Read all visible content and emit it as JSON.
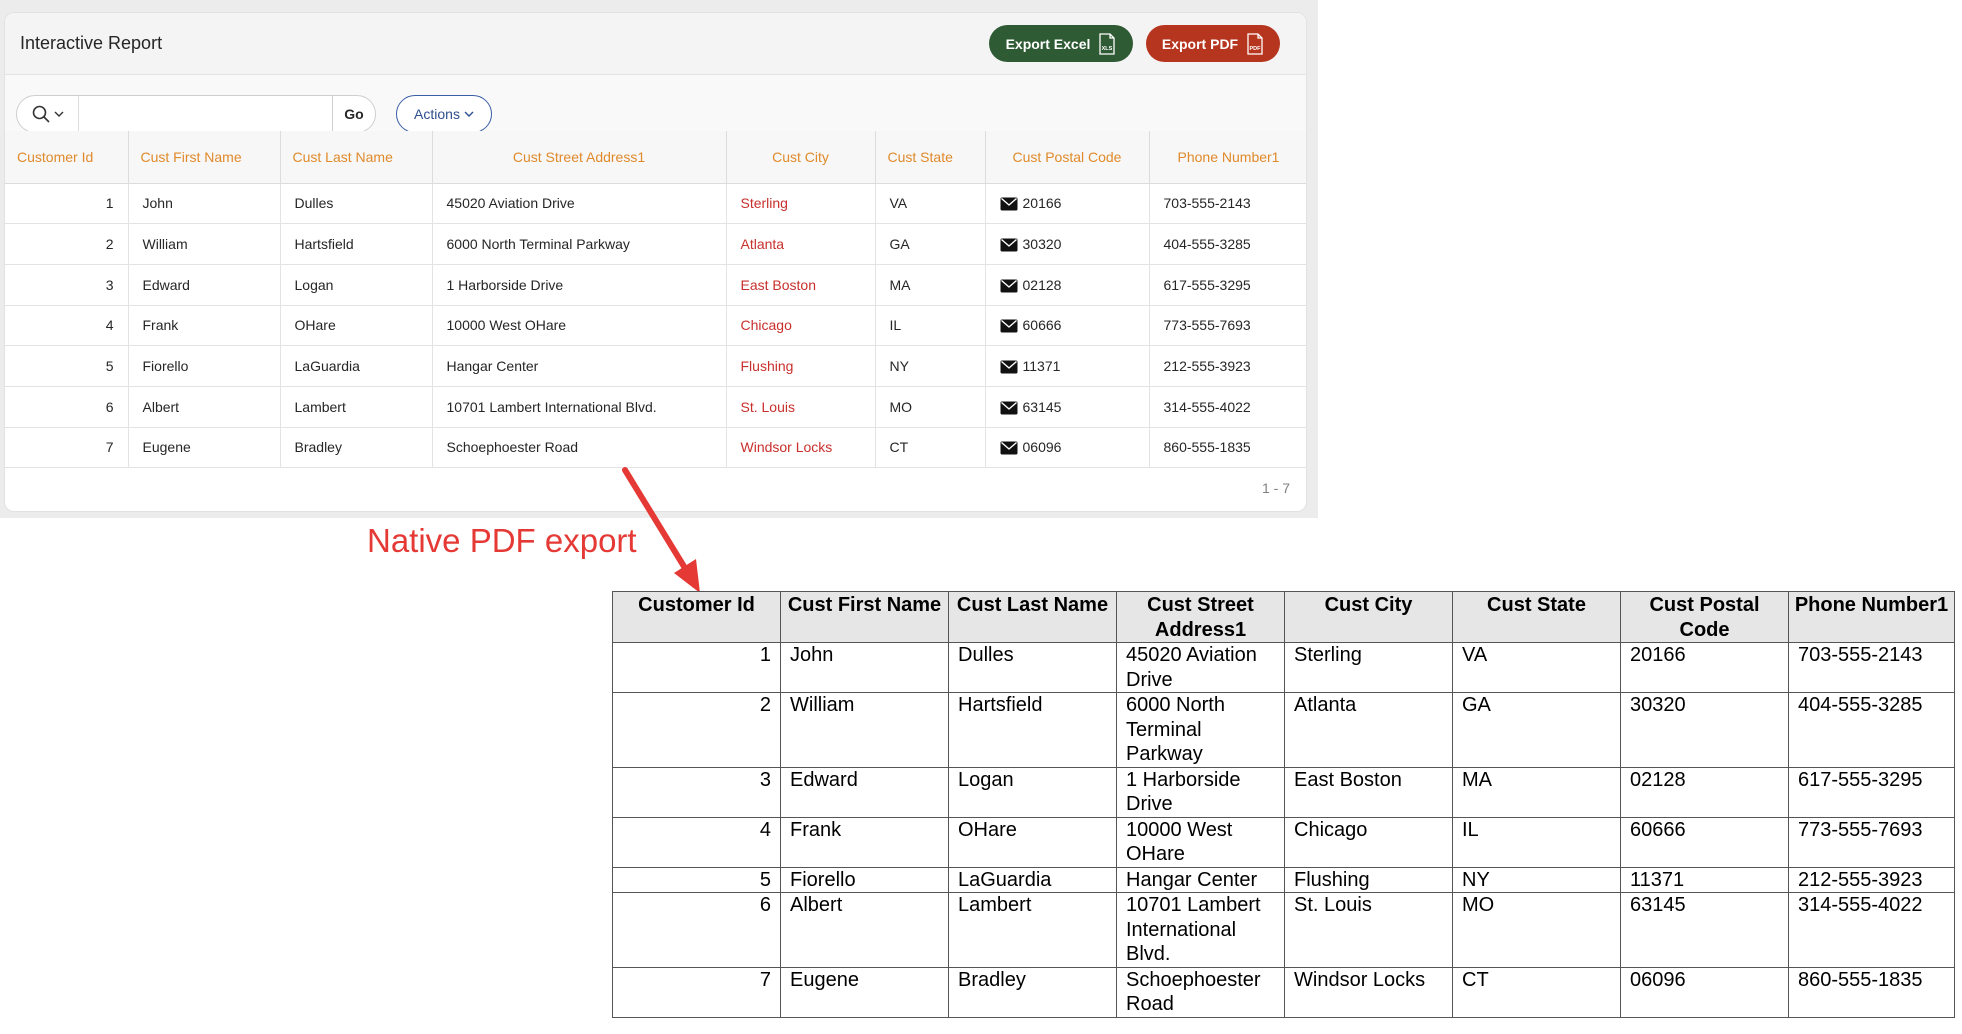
{
  "report": {
    "title": "Interactive Report",
    "export_excel_label": "Export Excel",
    "export_excel_icon": "xls-file-icon",
    "export_excel_icon_text": "XLS",
    "export_pdf_label": "Export PDF",
    "export_pdf_icon": "pdf-file-icon",
    "export_pdf_icon_text": "PDF",
    "search_placeholder": "",
    "search_icon": "magnifier-icon",
    "go_label": "Go",
    "actions_label": "Actions",
    "pagination": "1 - 7",
    "columns": [
      "Customer Id",
      "Cust First Name",
      "Cust Last Name",
      "Cust Street Address1",
      "Cust City",
      "Cust State",
      "Cust Postal Code",
      "Phone Number1"
    ],
    "rows": [
      [
        "1",
        "John",
        "Dulles",
        "45020 Aviation Drive",
        "Sterling",
        "VA",
        "20166",
        "703-555-2143"
      ],
      [
        "2",
        "William",
        "Hartsfield",
        "6000 North Terminal Parkway",
        "Atlanta",
        "GA",
        "30320",
        "404-555-3285"
      ],
      [
        "3",
        "Edward",
        "Logan",
        "1 Harborside Drive",
        "East Boston",
        "MA",
        "02128",
        "617-555-3295"
      ],
      [
        "4",
        "Frank",
        "OHare",
        "10000 West OHare",
        "Chicago",
        "IL",
        "60666",
        "773-555-7693"
      ],
      [
        "5",
        "Fiorello",
        "LaGuardia",
        "Hangar Center",
        "Flushing",
        "NY",
        "11371",
        "212-555-3923"
      ],
      [
        "6",
        "Albert",
        "Lambert",
        "10701 Lambert International Blvd.",
        "St. Louis",
        "MO",
        "63145",
        "314-555-4022"
      ],
      [
        "7",
        "Eugene",
        "Bradley",
        "Schoephoester Road",
        "Windsor Locks",
        "CT",
        "06096",
        "860-555-1835"
      ]
    ],
    "colors": {
      "header_text": "#e08a2b",
      "city_link": "#c9302c",
      "excel_button": "#2e5a34",
      "pdf_button": "#b6351f",
      "actions_border": "#3b5fa5"
    }
  },
  "callout": {
    "label": "Native PDF export",
    "color": "#e53935"
  },
  "pdf_table": {
    "columns": [
      "Customer Id",
      "Cust First Name",
      "Cust Last Name",
      "Cust Street Address1",
      "Cust City",
      "Cust State",
      "Cust Postal Code",
      "Phone Number1"
    ],
    "rows": [
      [
        "1",
        "John",
        "Dulles",
        "45020 Aviation Drive",
        "Sterling",
        "VA",
        "20166",
        "703-555-2143"
      ],
      [
        "2",
        "William",
        "Hartsfield",
        "6000 North Terminal Parkway",
        "Atlanta",
        "GA",
        "30320",
        "404-555-3285"
      ],
      [
        "3",
        "Edward",
        "Logan",
        "1 Harborside Drive",
        "East Boston",
        "MA",
        "02128",
        "617-555-3295"
      ],
      [
        "4",
        "Frank",
        "OHare",
        "10000 West OHare",
        "Chicago",
        "IL",
        "60666",
        "773-555-7693"
      ],
      [
        "5",
        "Fiorello",
        "LaGuardia",
        "Hangar Center",
        "Flushing",
        "NY",
        "11371",
        "212-555-3923"
      ],
      [
        "6",
        "Albert",
        "Lambert",
        "10701 Lambert International Blvd.",
        "St. Louis",
        "MO",
        "63145",
        "314-555-4022"
      ],
      [
        "7",
        "Eugene",
        "Bradley",
        "Schoephoester Road",
        "Windsor Locks",
        "CT",
        "06096",
        "860-555-1835"
      ]
    ]
  }
}
